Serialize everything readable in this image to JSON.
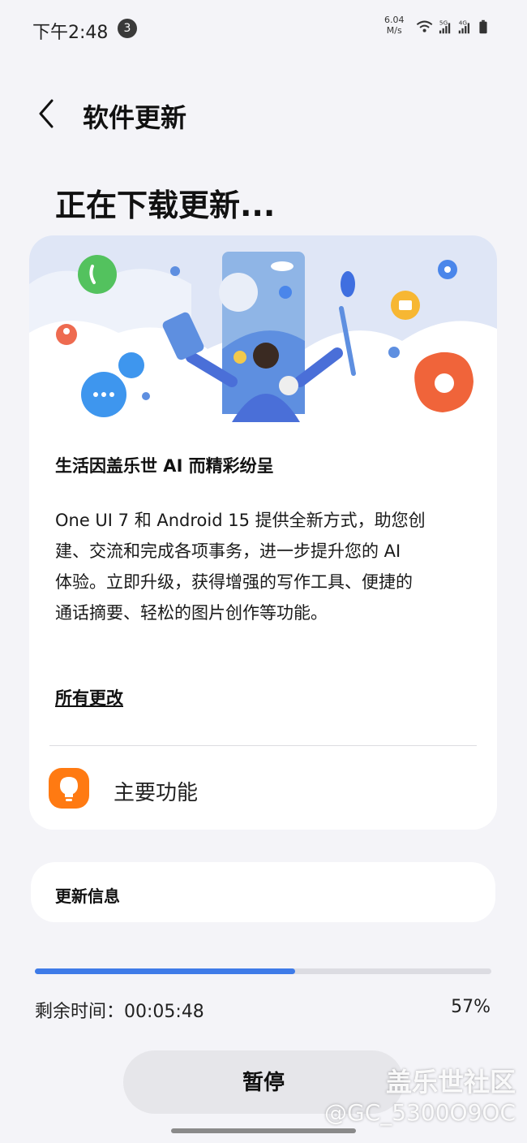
{
  "status_bar": {
    "time": "下午2:48",
    "notification_count": "3",
    "net_speed_value": "6.04",
    "net_speed_unit": "M/s",
    "signal_1": "5G",
    "signal_2": "4G"
  },
  "header": {
    "title": "软件更新",
    "back_icon": "chevron-left-icon"
  },
  "heading": "正在下载更新...",
  "feature_card": {
    "subtitle": "生活因盖乐世 AI 而精彩纷呈",
    "description_lines": [
      "One UI 7 和 Android 15 提供全新方式，助您创",
      "建、交流和完成各项事务，进一步提升您的 AI",
      "体验。立即升级，获得增强的写作工具、便捷的",
      "通话摘要、轻松的图片创作等功能。"
    ],
    "all_changes_link": "所有更改",
    "main_features_label": "主要功能",
    "main_features_icon": "lightbulb-icon"
  },
  "update_info_label": "更新信息",
  "progress": {
    "fraction": 0.57,
    "time_remaining": "剩余时间：00:05:48",
    "percent_text": "57%"
  },
  "pause_button_label": "暂停",
  "watermark": {
    "brand": "盖乐世社区",
    "user": "@GC_5300O9OC"
  },
  "colors": {
    "accent": "#3e7be8",
    "bulb_orange": "#ff7a12",
    "background": "#f4f4f8"
  }
}
